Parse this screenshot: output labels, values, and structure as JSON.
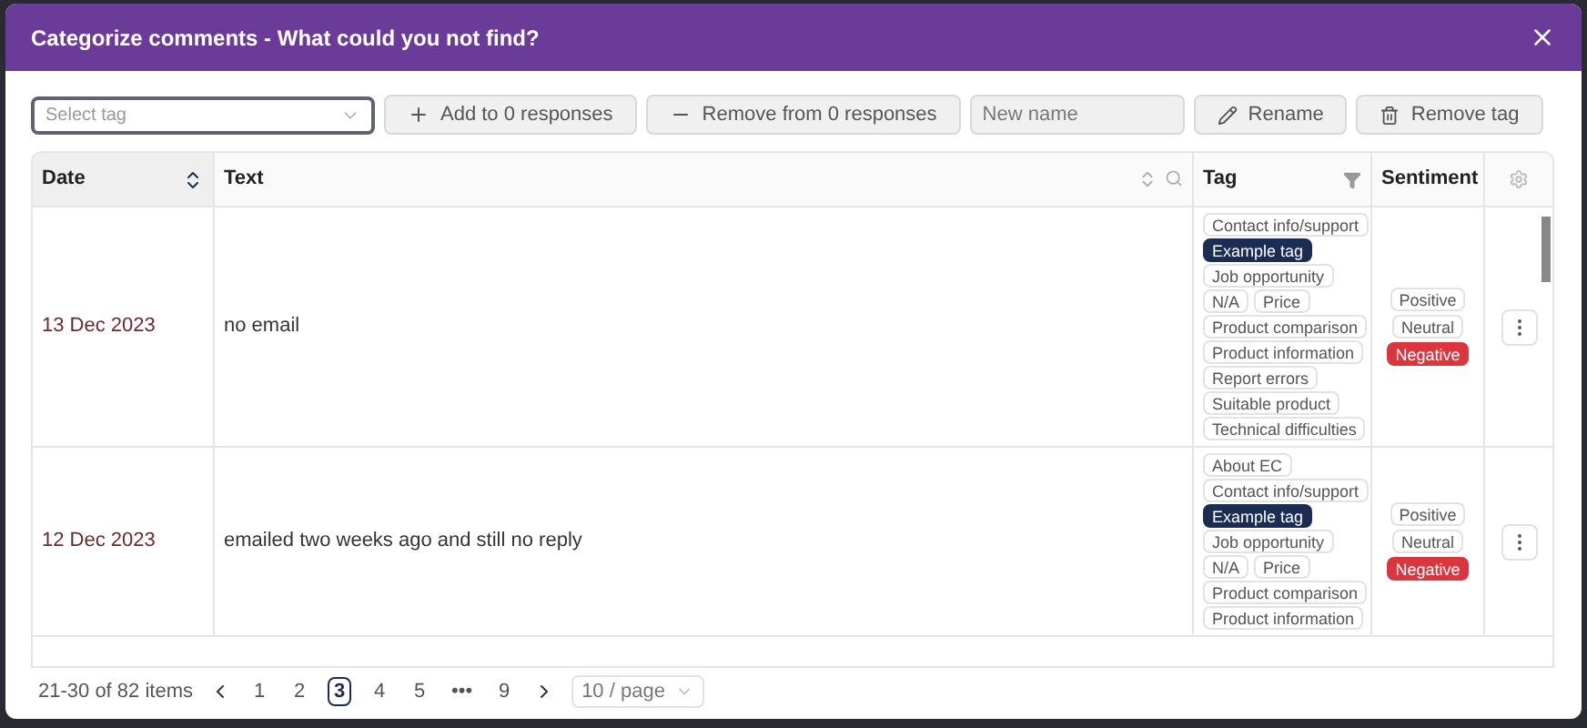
{
  "dialog": {
    "title": "Categorize comments - What could you not find?"
  },
  "toolbar": {
    "tag_select": {
      "placeholder": "Select tag"
    },
    "add_button": "Add to 0 responses",
    "remove_button": "Remove from 0 responses",
    "name_field": {
      "placeholder": "New name"
    },
    "rename_button": "Rename",
    "remove_tag_button": "Remove tag"
  },
  "table": {
    "columns": [
      "Date",
      "Text",
      "Tag",
      "Sentiment"
    ],
    "rows": [
      {
        "date": "13 Dec 2023",
        "text": "no email",
        "tags": [
          {
            "label": "Contact info/support",
            "selected": false
          },
          {
            "label": "Example tag",
            "selected": true
          },
          {
            "label": "Job opportunity",
            "selected": false
          },
          {
            "label": "N/A",
            "selected": false
          },
          {
            "label": "Price",
            "selected": false
          },
          {
            "label": "Product comparison",
            "selected": false
          },
          {
            "label": "Product information",
            "selected": false
          },
          {
            "label": "Report errors",
            "selected": false
          },
          {
            "label": "Suitable product",
            "selected": false
          },
          {
            "label": "Technical difficulties",
            "selected": false
          }
        ],
        "sentiments": [
          {
            "label": "Positive",
            "selected": false
          },
          {
            "label": "Neutral",
            "selected": false
          },
          {
            "label": "Negative",
            "selected": true
          }
        ]
      },
      {
        "date": "12 Dec 2023",
        "text": "emailed two weeks ago and still no reply",
        "tags": [
          {
            "label": "About EC",
            "selected": false
          },
          {
            "label": "Contact info/support",
            "selected": false
          },
          {
            "label": "Example tag",
            "selected": true
          },
          {
            "label": "Job opportunity",
            "selected": false
          },
          {
            "label": "N/A",
            "selected": false
          },
          {
            "label": "Price",
            "selected": false
          },
          {
            "label": "Product comparison",
            "selected": false
          },
          {
            "label": "Product information",
            "selected": false
          }
        ],
        "sentiments": [
          {
            "label": "Positive",
            "selected": false
          },
          {
            "label": "Neutral",
            "selected": false
          },
          {
            "label": "Negative",
            "selected": true
          }
        ]
      }
    ]
  },
  "pagination": {
    "summary": "21-30 of 82 items",
    "pages": [
      {
        "label": "1",
        "selected": false
      },
      {
        "label": "2",
        "selected": false
      },
      {
        "label": "3",
        "selected": true
      },
      {
        "label": "4",
        "selected": false
      },
      {
        "label": "5",
        "selected": false
      },
      {
        "label": "•••",
        "selected": false
      },
      {
        "label": "9",
        "selected": false
      }
    ],
    "page_size": "10 / page"
  }
}
